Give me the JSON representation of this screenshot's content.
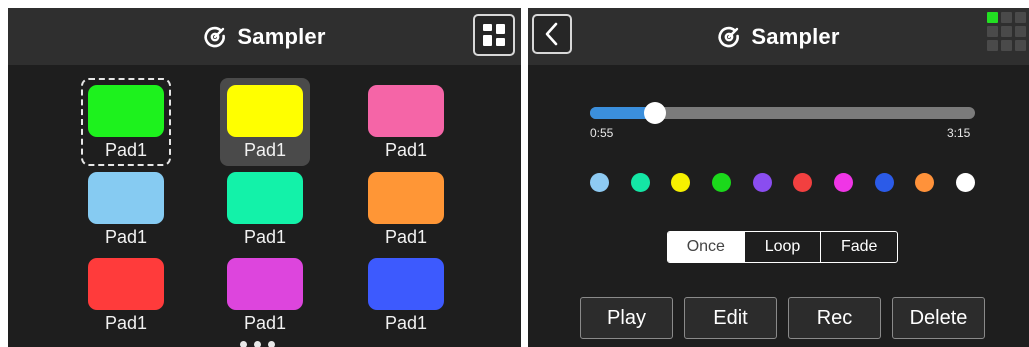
{
  "left": {
    "header": {
      "title": "Sampler",
      "title_icon": "sampler-icon",
      "layout_icon": "layout-switch-icon"
    },
    "pads": [
      {
        "label": "Pad1",
        "color": "#1df21d",
        "state": "dashed"
      },
      {
        "label": "Pad1",
        "color": "#ffff00",
        "state": "selected"
      },
      {
        "label": "Pad1",
        "color": "#f565a7",
        "state": "normal"
      },
      {
        "label": "Pad1",
        "color": "#86cbf2",
        "state": "normal"
      },
      {
        "label": "Pad1",
        "color": "#13f2a9",
        "state": "normal"
      },
      {
        "label": "Pad1",
        "color": "#ff9636",
        "state": "normal"
      },
      {
        "label": "Pad1",
        "color": "#ff3b3b",
        "state": "normal"
      },
      {
        "label": "Pad1",
        "color": "#dd45dd",
        "state": "normal"
      },
      {
        "label": "Pad1",
        "color": "#3d5afe",
        "state": "normal"
      }
    ],
    "page_dot_count": 3
  },
  "right": {
    "header": {
      "title": "Sampler",
      "title_icon": "sampler-icon",
      "back_icon": "back-chevron-icon",
      "grid_icon": "pad-grid-icon"
    },
    "mini_grid": {
      "active_index": 0,
      "cells": 9
    },
    "playback": {
      "current": "0:55",
      "total": "3:15",
      "progress": 0.17
    },
    "colors": [
      "#8ecaf2",
      "#14e6a5",
      "#f6f000",
      "#1bd91b",
      "#8a4df0",
      "#f24040",
      "#f035e6",
      "#2b5be8",
      "#ff923a",
      "#ffffff"
    ],
    "modes": [
      {
        "label": "Once",
        "active": true
      },
      {
        "label": "Loop",
        "active": false
      },
      {
        "label": "Fade",
        "active": false
      }
    ],
    "actions": [
      {
        "label": "Play",
        "name": "play-button"
      },
      {
        "label": "Edit",
        "name": "edit-button"
      },
      {
        "label": "Rec",
        "name": "rec-button"
      },
      {
        "label": "Delete",
        "name": "delete-button"
      }
    ]
  }
}
